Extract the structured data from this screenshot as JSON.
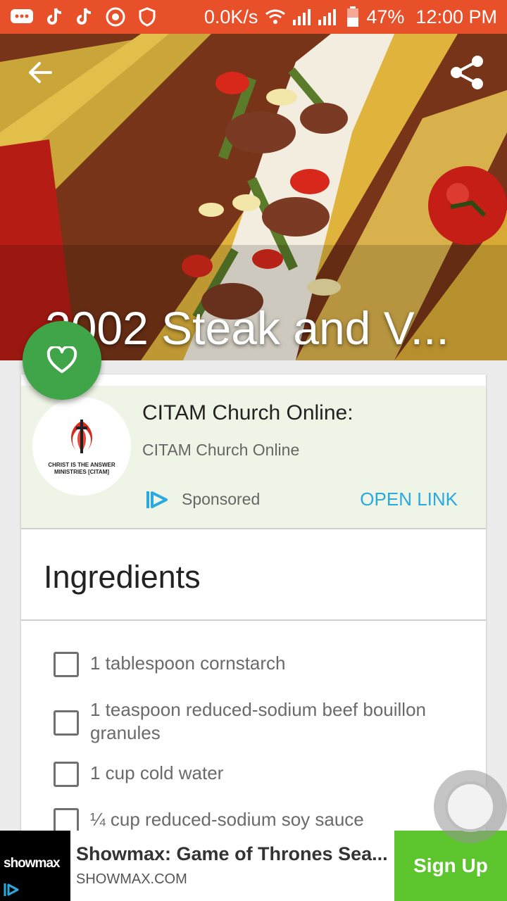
{
  "status_bar": {
    "network_speed": "0.0K/s",
    "battery": "47%",
    "time": "12:00 PM"
  },
  "recipe": {
    "title": "2002 Steak and V..."
  },
  "ad_card": {
    "logo_text": "CHRIST IS THE ANSWER MINISTRIES [CITAM]",
    "title": "CITAM Church Online:",
    "subtitle": "CITAM Church Online",
    "sponsored_label": "Sponsored",
    "cta": "OPEN LINK"
  },
  "ingredients": {
    "heading": "Ingredients",
    "items": [
      "1 tablespoon cornstarch",
      "1 teaspoon reduced-sodium beef bouillon granules",
      "1 cup cold water",
      "¼ cup reduced-sodium soy sauce"
    ]
  },
  "bottom_ad": {
    "brand": "showmax",
    "title": "Showmax: Game of Thrones Sea...",
    "domain": "SHOWMAX.COM",
    "cta": "Sign Up"
  },
  "colors": {
    "status_bar": "#e8502a",
    "fab": "#3fa548",
    "ad_background": "#eef5e6",
    "link": "#2aa9e0",
    "signup": "#5cc42c"
  },
  "icons": [
    "message-icon",
    "tiktok-icon",
    "chrome-icon",
    "shield-icon",
    "wifi-icon",
    "signal-icon",
    "battery-icon",
    "back-arrow-icon",
    "share-icon",
    "heart-icon",
    "sponsored-icon",
    "floating-circle-icon"
  ]
}
